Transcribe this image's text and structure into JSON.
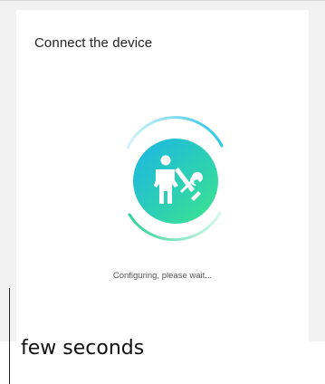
{
  "screen": {
    "title": "Connect the device",
    "status": "Configuring, please wait...",
    "icon": "technician-with-tools-icon",
    "accent_colors": [
      "#24c1e0",
      "#38e28a"
    ]
  },
  "caption": "few seconds"
}
